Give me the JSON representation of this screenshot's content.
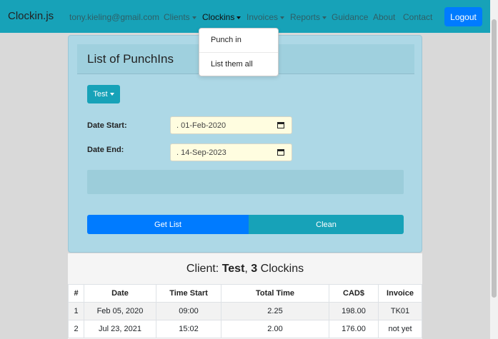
{
  "navbar": {
    "brand": "Clockin.js",
    "user_email": "tony.kieling@gmail.com",
    "links": [
      "Clients",
      "Clockins",
      "Invoices",
      "Reports",
      "Guidance",
      "About",
      "Contact"
    ],
    "logout_label": "Logout"
  },
  "dropdown": {
    "items": [
      "Punch in",
      "List them all"
    ]
  },
  "card": {
    "title": "List of PunchIns",
    "client_button": "Test",
    "date_start_label": "Date Start:",
    "date_start_value": ". 01-Feb-2020",
    "date_end_label": "Date End:",
    "date_end_value": ". 14-Sep-2023",
    "get_list_label": "Get List",
    "clean_label": "Clean"
  },
  "results": {
    "prefix": "Client: ",
    "client": "Test",
    "separator": ", ",
    "count": "3",
    "suffix": " Clockins",
    "columns": [
      "#",
      "Date",
      "Time Start",
      "Total Time",
      "CAD$",
      "Invoice"
    ],
    "rows": [
      [
        "1",
        "Feb 05, 2020",
        "09:00",
        "2.25",
        "198.00",
        "TK01"
      ],
      [
        "2",
        "Jul 23, 2021",
        "15:02",
        "2.00",
        "176.00",
        "not yet"
      ]
    ]
  },
  "colors": {
    "navbar": "#17a2b8",
    "primary": "#007bff",
    "card": "#add8e6",
    "date_bg": "#fffde0"
  }
}
